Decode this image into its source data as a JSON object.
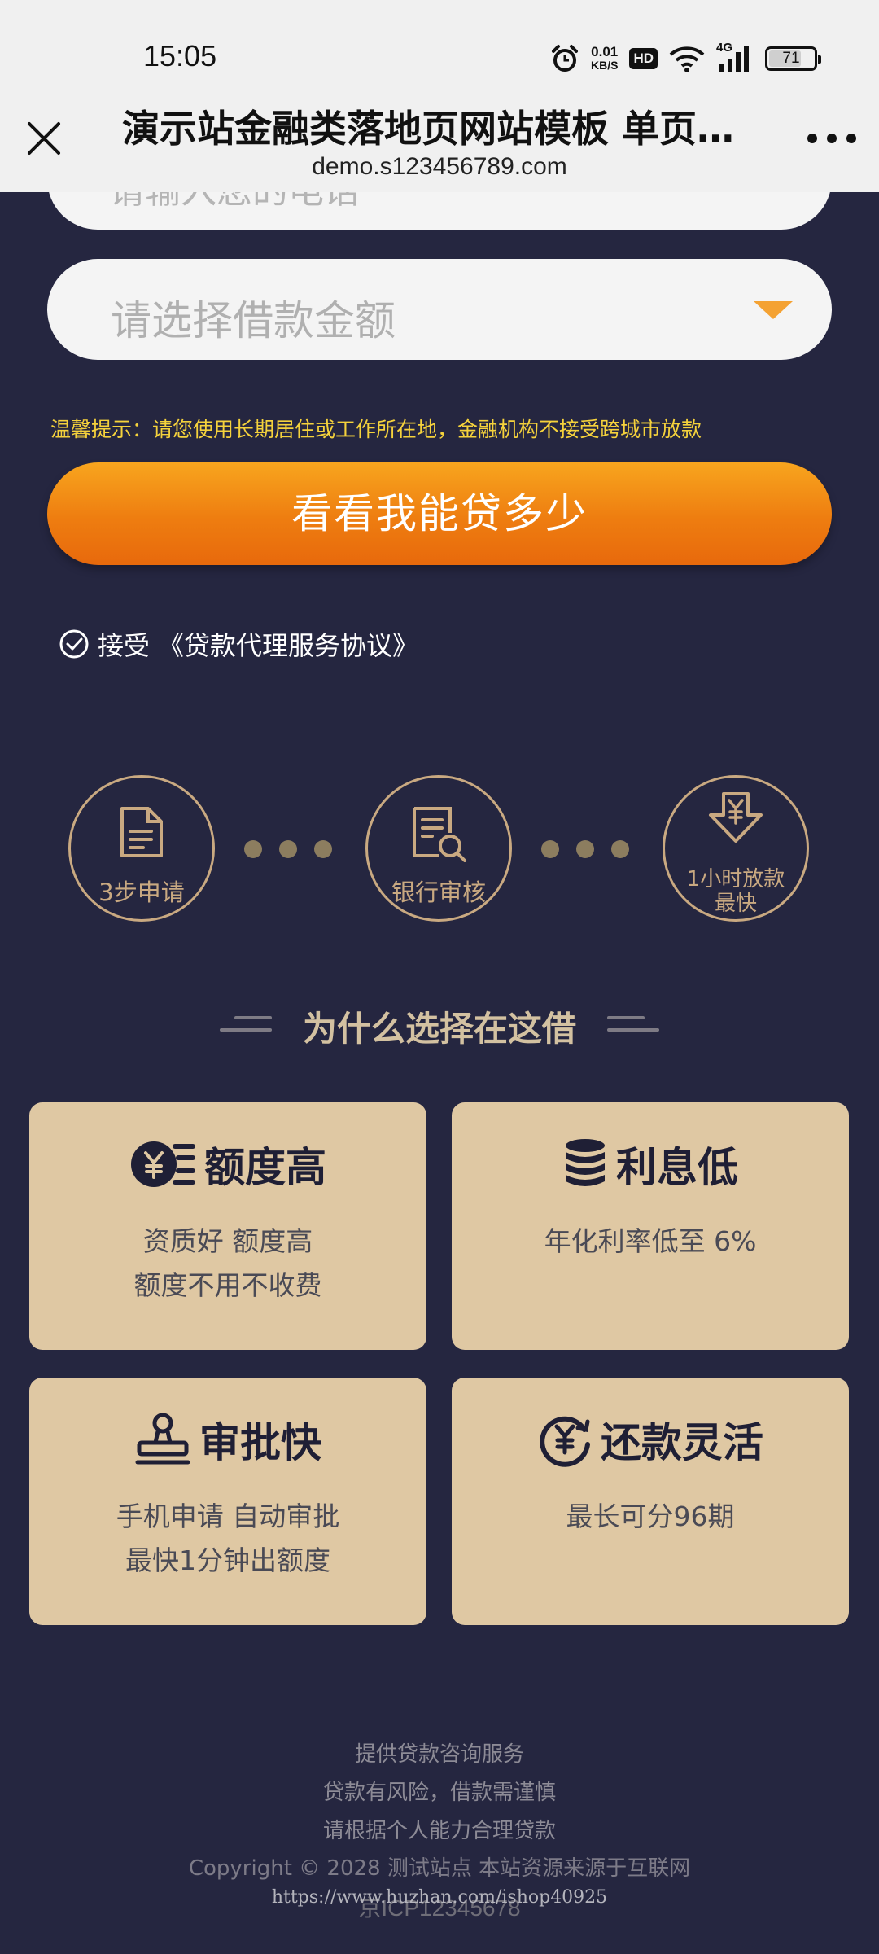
{
  "status_bar": {
    "time": "15:05",
    "net_speed_value": "0.01",
    "net_speed_unit": "KB/S",
    "hd": "HD",
    "signal_label": "4G",
    "battery": "71",
    "battery_level": 0.71
  },
  "browser": {
    "title": "演示站金融类落地页网站模板 单页金...",
    "url": "demo.s123456789.com"
  },
  "form": {
    "top_input_placeholder": "请输入您的电话",
    "amount_placeholder": "请选择借款金额",
    "tip": "温馨提示：请您使用长期居住或工作所在地，金融机构不接受跨城市放款",
    "cta_label": "看看我能贷多少",
    "agree_prefix": "接受",
    "agree_link": "《贷款代理服务协议》"
  },
  "steps": [
    {
      "label": "3步申请"
    },
    {
      "label": "银行审核"
    },
    {
      "label_line1": "1小时放款",
      "label_line2": "最快"
    }
  ],
  "section_title": "为什么选择在这借",
  "features": [
    {
      "title": "额度高",
      "lines": [
        "资质好   额度高",
        "额度不用不收费"
      ]
    },
    {
      "title": "利息低",
      "lines": [
        "年化利率低至 6%"
      ]
    },
    {
      "title": "审批快",
      "lines": [
        "手机申请 自动审批",
        "最快1分钟出额度"
      ]
    },
    {
      "title": "还款灵活",
      "lines": [
        "最长可分96期"
      ]
    }
  ],
  "footer": {
    "line1": "提供贷款咨询服务",
    "line2": "贷款有风险，借款需谨慎",
    "line3": "请根据个人能力合理贷款",
    "copyright": "Copyright © 2028 测试站点 本站资源来源于互联网",
    "icp": "京ICP12345678",
    "watermark": "https://www.huzhan.com/ishop40925"
  },
  "colors": {
    "background": "#252640",
    "accent_orange": "#ee7d10",
    "gold": "#c9a981",
    "card": "#dfc8a3",
    "tip_yellow": "#f5d23c"
  }
}
